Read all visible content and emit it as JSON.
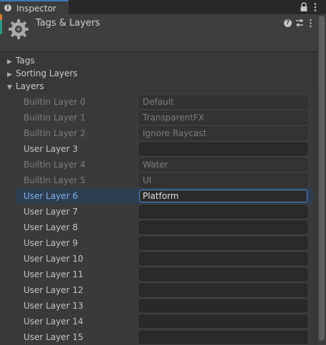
{
  "tab": {
    "label": "Inspector",
    "info_glyph": "i"
  },
  "header": {
    "title": "Tags & Layers",
    "help_glyph": "?"
  },
  "foldouts": [
    {
      "label": "Tags",
      "expanded": false
    },
    {
      "label": "Sorting Layers",
      "expanded": false
    },
    {
      "label": "Layers",
      "expanded": true
    }
  ],
  "layers": [
    {
      "label": "Builtin Layer 0",
      "value": "Default",
      "builtin": true,
      "selected": false
    },
    {
      "label": "Builtin Layer 1",
      "value": "TransparentFX",
      "builtin": true,
      "selected": false
    },
    {
      "label": "Builtin Layer 2",
      "value": "Ignore Raycast",
      "builtin": true,
      "selected": false
    },
    {
      "label": "User Layer 3",
      "value": "",
      "builtin": false,
      "selected": false
    },
    {
      "label": "Builtin Layer 4",
      "value": "Water",
      "builtin": true,
      "selected": false
    },
    {
      "label": "Builtin Layer 5",
      "value": "UI",
      "builtin": true,
      "selected": false
    },
    {
      "label": "User Layer 6",
      "value": "Platform",
      "builtin": false,
      "selected": true
    },
    {
      "label": "User Layer 7",
      "value": "",
      "builtin": false,
      "selected": false
    },
    {
      "label": "User Layer 8",
      "value": "",
      "builtin": false,
      "selected": false
    },
    {
      "label": "User Layer 9",
      "value": "",
      "builtin": false,
      "selected": false
    },
    {
      "label": "User Layer 10",
      "value": "",
      "builtin": false,
      "selected": false
    },
    {
      "label": "User Layer 11",
      "value": "",
      "builtin": false,
      "selected": false
    },
    {
      "label": "User Layer 12",
      "value": "",
      "builtin": false,
      "selected": false
    },
    {
      "label": "User Layer 13",
      "value": "",
      "builtin": false,
      "selected": false
    },
    {
      "label": "User Layer 14",
      "value": "",
      "builtin": false,
      "selected": false
    },
    {
      "label": "User Layer 15",
      "value": "",
      "builtin": false,
      "selected": false
    }
  ],
  "colors": {
    "accent": "#3a79bb",
    "selected_row": "#2e3e52",
    "focus_border": "#4f8bd6"
  },
  "icons": [
    "info-icon",
    "lock-icon",
    "kebab-menu-icon",
    "gear-icon",
    "help-icon",
    "preset-icon",
    "foldout-arrow-icon"
  ]
}
